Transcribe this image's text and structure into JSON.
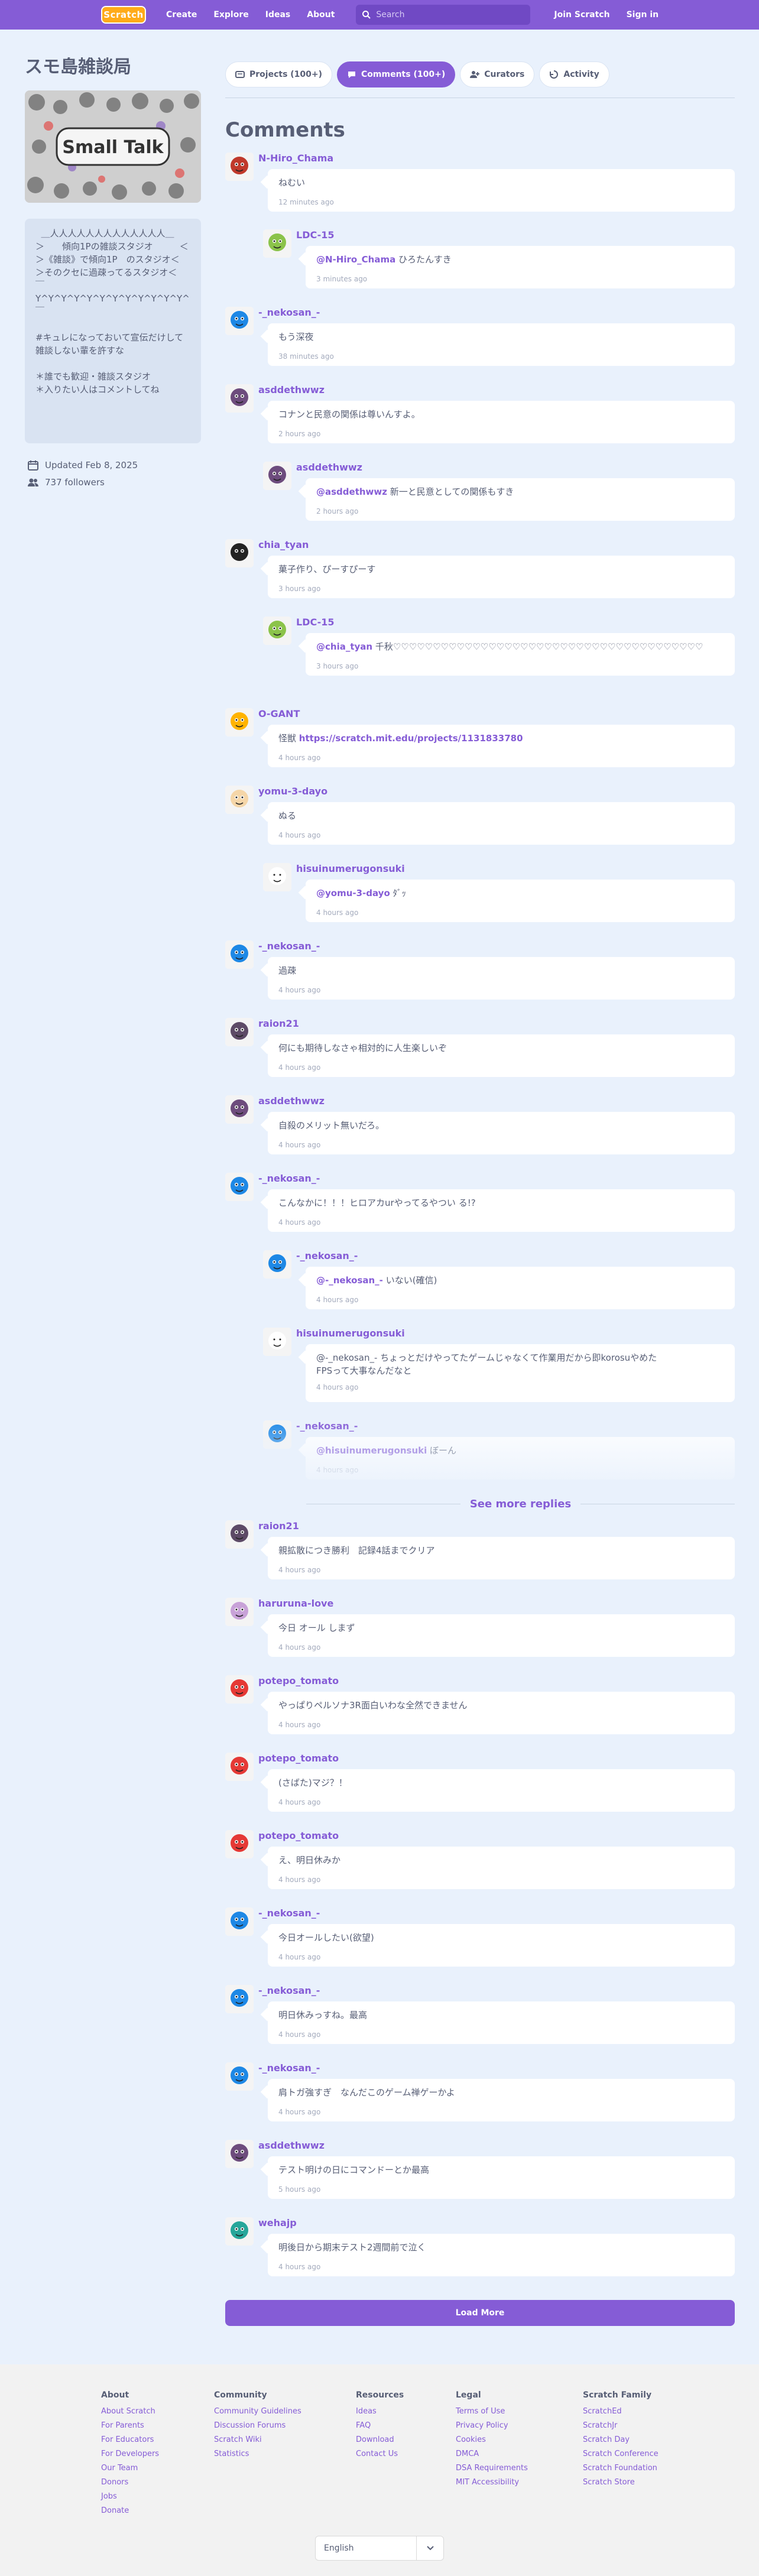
{
  "navbar": {
    "logo_text": "Scratch",
    "links": [
      "Create",
      "Explore",
      "Ideas",
      "About"
    ],
    "search_placeholder": "Search",
    "join": "Join Scratch",
    "signin": "Sign in"
  },
  "studio": {
    "title": "スモ島雑談局",
    "thumb_text": "Small Talk",
    "description": "  ＿人人人人人人人人人人人人人＿\n＞　　傾向1Pの雑談スタジオ　　　＜\n＞《雑談》で傾向1P　のスタジオ＜\n＞そのクセに過疎ってるスタジオ＜\n￣Y^Y^Y^Y^Y^Y^Y^Y^Y^Y^Y^Y^￣\n\n#キュレになっておいて宣伝だけして雑談しない輩を許すな\n\n＊誰でも歓迎・雑談スタジオ\n＊入りたい人はコメントしてね",
    "updated": "Updated Feb 8, 2025",
    "followers": "737 followers"
  },
  "tabs": [
    {
      "label": "Projects (100+)",
      "icon": "projects-icon"
    },
    {
      "label": "Comments (100+)",
      "icon": "comments-icon"
    },
    {
      "label": "Curators",
      "icon": "curators-icon"
    },
    {
      "label": "Activity",
      "icon": "activity-icon"
    }
  ],
  "comments_heading": "Comments",
  "comments": [
    {
      "user": "N-Hiro_Chama",
      "text": "ねむい",
      "time": "12 minutes ago",
      "avatar_color": "#c0392b"
    },
    {
      "user": "LDC-15",
      "mention": "@N-Hiro_Chama",
      "text": " ひろたんすき",
      "time": "3 minutes ago",
      "avatar_color": "#8bc34a"
    },
    {
      "user": "-_nekosan_-",
      "text": "もう深夜",
      "time": "38 minutes ago",
      "avatar_color": "#1e88e5"
    },
    {
      "user": "asddethwwz",
      "text": "コナンと民意の関係は尊いんすよ。",
      "time": "2 hours ago",
      "avatar_color": "#6d4c7d"
    },
    {
      "user": "asddethwwz",
      "mention": "@asddethwwz",
      "text": " 新一と民意としての関係もすき",
      "time": "2 hours ago",
      "avatar_color": "#6d4c7d"
    },
    {
      "user": "chia_tyan",
      "text": "菓子作り、ぴーすぴーす",
      "time": "3 hours ago",
      "avatar_color": "#222222"
    },
    {
      "user": "LDC-15",
      "mention": "@chia_tyan",
      "text": " 千秋♡♡♡♡♡♡♡♡♡♡♡♡♡♡♡♡♡♡♡♡♡♡♡♡♡♡♡♡♡♡♡♡♡♡♡♡♡♡♡",
      "time": "3 hours ago",
      "avatar_color": "#8bc34a"
    },
    {
      "user": "O-GANT",
      "text": "怪獣 ",
      "link": "https://scratch.mit.edu/projects/1131833780",
      "time": "4 hours ago",
      "avatar_color": "#ffb300"
    },
    {
      "user": "yomu-3-dayo",
      "text": "ぬる",
      "time": "4 hours ago",
      "avatar_color": "#f5d6a8"
    },
    {
      "user": "hisuinumerugonsuki",
      "mention": "@yomu-3-dayo",
      "text": " ﾀﾞｯ",
      "time": "4 hours ago",
      "avatar_color": "#ffffff"
    },
    {
      "user": "-_nekosan_-",
      "text": "過疎",
      "time": "4 hours ago",
      "avatar_color": "#1e88e5"
    },
    {
      "user": "raion21",
      "text": "何にも期待しなさゃ相対的に人生楽しいぞ",
      "time": "4 hours ago",
      "avatar_color": "#5d4a66"
    },
    {
      "user": "asddethwwz",
      "text": "自殺のメリット無いだろ。",
      "time": "4 hours ago",
      "avatar_color": "#6d4c7d"
    },
    {
      "user": "-_nekosan_-",
      "text": "こんなかに！！！ヒロアカurやってるやつい る!?",
      "time": "4 hours ago",
      "avatar_color": "#1e88e5"
    },
    {
      "user": "-_nekosan_-",
      "mention": "@-_nekosan_-",
      "text": " いない(確信)",
      "time": "4 hours ago",
      "avatar_color": "#1e88e5"
    },
    {
      "user": "hisuinumerugonsuki",
      "mention": "@-_nekosan_-",
      "text": " ちょっとだけやってたゲームじゃなくて作業用だから即korosuやめた",
      "text2": "FPSって大事なんだなと",
      "time": "4 hours ago",
      "avatar_color": "#ffffff"
    },
    {
      "user": "-_nekosan_-",
      "mention": "@hisuinumerugonsuki",
      "text": " ぼーん",
      "time": "4 hours ago",
      "avatar_color": "#1e88e5"
    },
    {
      "user": "raion21",
      "text": "親拡散につき勝利　記録4話までクリア",
      "time": "4 hours ago",
      "avatar_color": "#5d4a66"
    },
    {
      "user": "haruruna-love",
      "text": "今日 オール しまず",
      "time": "4 hours ago",
      "avatar_color": "#c8a2d8"
    },
    {
      "user": "potepo_tomato",
      "text": "やっぱりペルソナ3R面白いわな全然できません",
      "time": "4 hours ago",
      "avatar_color": "#e53935"
    },
    {
      "user": "potepo_tomato",
      "text": "(さばた)マジ？！",
      "time": "4 hours ago",
      "avatar_color": "#e53935"
    },
    {
      "user": "potepo_tomato",
      "text": "え、明日休みか",
      "time": "4 hours ago",
      "avatar_color": "#e53935"
    },
    {
      "user": "-_nekosan_-",
      "text": "今日オールしたい(欲望)",
      "time": "4 hours ago",
      "avatar_color": "#1e88e5"
    },
    {
      "user": "-_nekosan_-",
      "text": "明日休みっすね。最高",
      "time": "4 hours ago",
      "avatar_color": "#1e88e5"
    },
    {
      "user": "-_nekosan_-",
      "text": "肩トガ強すぎ　なんだこのゲーム禅ゲーかよ",
      "time": "4 hours ago",
      "avatar_color": "#1e88e5"
    },
    {
      "user": "asddethwwz",
      "text": "テスト明けの日にコマンドーとか最高",
      "time": "5 hours ago",
      "avatar_color": "#6d4c7d"
    },
    {
      "user": "wehajp",
      "text": "明後日から期末テスト2週間前で泣く",
      "time": "4 hours ago",
      "avatar_color": "#26a69a"
    }
  ],
  "see_more": "See more replies",
  "load_more": "Load More",
  "footer": {
    "columns": [
      {
        "title": "About",
        "links": [
          "About Scratch",
          "For Parents",
          "For Educators",
          "For Developers",
          "Our Team",
          "Donors",
          "Jobs",
          "Donate"
        ]
      },
      {
        "title": "Community",
        "links": [
          "Community Guidelines",
          "Discussion Forums",
          "Scratch Wiki",
          "Statistics"
        ]
      },
      {
        "title": "Resources",
        "links": [
          "Ideas",
          "FAQ",
          "Download",
          "Contact Us"
        ]
      },
      {
        "title": "Legal",
        "links": [
          "Terms of Use",
          "Privacy Policy",
          "Cookies",
          "DMCA",
          "DSA Requirements",
          "MIT Accessibility"
        ]
      },
      {
        "title": "Scratch Family",
        "links": [
          "ScratchEd",
          "ScratchJr",
          "Scratch Day",
          "Scratch Conference",
          "Scratch Foundation",
          "Scratch Store"
        ]
      }
    ],
    "language": "English"
  },
  "colors": {
    "accent": "#855cd6",
    "background": "#e9f1fc",
    "text": "#575e75"
  }
}
